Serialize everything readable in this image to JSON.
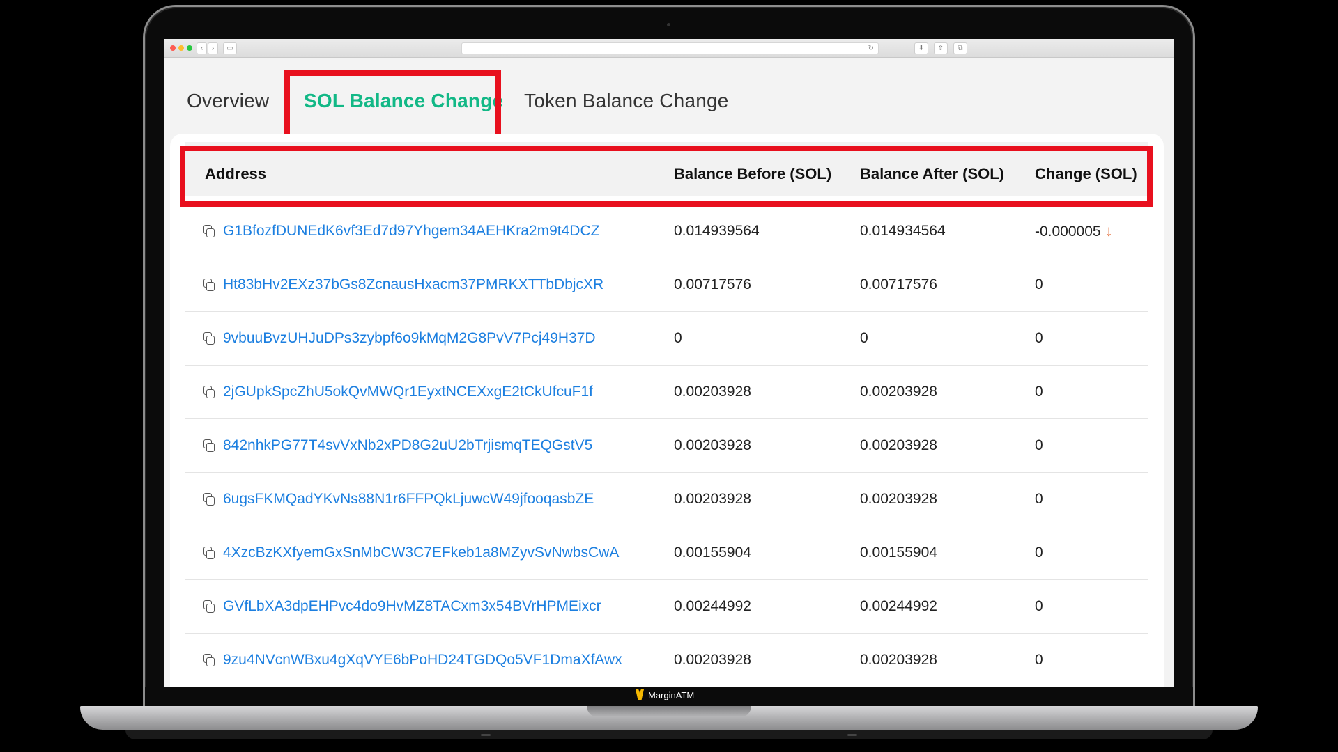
{
  "page": {
    "tabs": [
      {
        "label": "Overview"
      },
      {
        "label": "SOL Balance Change"
      },
      {
        "label": "Token Balance Change"
      }
    ],
    "table": {
      "headers": {
        "address": "Address",
        "before": "Balance Before (SOL)",
        "after": "Balance After (SOL)",
        "change": "Change (SOL)"
      },
      "rows": [
        {
          "address": "G1BfozfDUNEdK6vf3Ed7d97Yhgem34AEHKra2m9t4DCZ",
          "before": "0.014939564",
          "after": "0.014934564",
          "change": "-0.000005"
        },
        {
          "address": "Ht83bHv2EXz37bGs8ZcnausHxacm37PMRKXTTbDbjcXR",
          "before": "0.00717576",
          "after": "0.00717576",
          "change": "0"
        },
        {
          "address": "9vbuuBvzUHJuDPs3zybpf6o9kMqM2G8PvV7Pcj49H37D",
          "before": "0",
          "after": "0",
          "change": "0"
        },
        {
          "address": "2jGUpkSpcZhU5okQvMWQr1EyxtNCEXxgE2tCkUfcuF1f",
          "before": "0.00203928",
          "after": "0.00203928",
          "change": "0"
        },
        {
          "address": "842nhkPG77T4svVxNb2xPD8G2uU2bTrjismqTEQGstV5",
          "before": "0.00203928",
          "after": "0.00203928",
          "change": "0"
        },
        {
          "address": "6ugsFKMQadYKvNs88N1r6FFPQkLjuwcW49jfooqasbZE",
          "before": "0.00203928",
          "after": "0.00203928",
          "change": "0"
        },
        {
          "address": "4XzcBzKXfyemGxSnMbCW3C7EFkeb1a8MZyvSvNwbsCwA",
          "before": "0.00155904",
          "after": "0.00155904",
          "change": "0"
        },
        {
          "address": "GVfLbXA3dpEHPvc4do9HvMZ8TACxm3x54BVrHPMEixcr",
          "before": "0.00244992",
          "after": "0.00244992",
          "change": "0"
        },
        {
          "address": "9zu4NVcnWBxu4gXqVYE6bPoHD24TGDQo5VF1DmaXfAwx",
          "before": "0.00203928",
          "after": "0.00203928",
          "change": "0"
        }
      ]
    }
  },
  "laptop": {
    "brand": "MarginATM"
  },
  "colors": {
    "accent": "#12b886",
    "link": "#1c7fe0",
    "highlight": "#e8101e",
    "negative": "#e05a1f"
  },
  "icons": [
    "copy-icon",
    "arrow-down-icon",
    "reload-icon",
    "back-icon",
    "forward-icon",
    "sidebar-icon",
    "download-icon",
    "share-icon",
    "tabs-icon"
  ]
}
